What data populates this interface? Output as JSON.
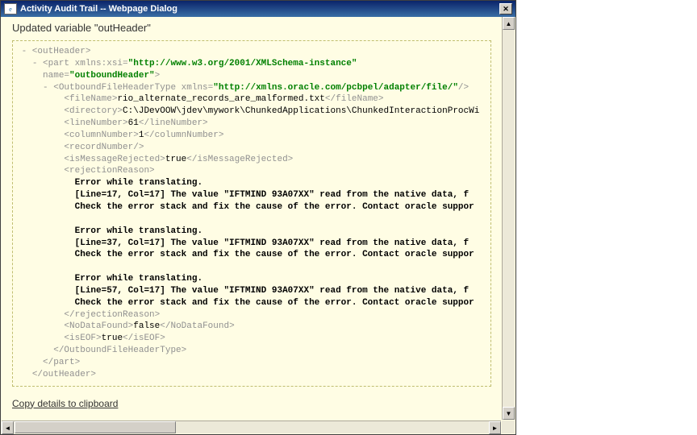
{
  "window": {
    "title": "Activity Audit Trail -- Webpage Dialog"
  },
  "heading": "Updated variable \"outHeader\"",
  "xml": {
    "root_open": "- <outHeader>",
    "part_open_pre": "- <part ",
    "part_attr_ns_name": "xmlns:xsi=",
    "part_attr_ns_val": "\"http://www.w3.org/2001/XMLSchema-instance\"",
    "part_attr_name_name": "name=",
    "part_attr_name_val": "\"outboundHeader\"",
    "close_angle": ">",
    "ofht_open_pre": "- <OutboundFileHeaderType ",
    "ofht_attr_ns_name": "xmlns=",
    "ofht_attr_ns_val": "\"http://xmlns.oracle.com/pcbpel/adapter/file/\"",
    "slash_close": "/>",
    "fileName_open": "<fileName>",
    "fileName_val": "rio_alternate_records_are_malformed.txt",
    "fileName_close": "</fileName>",
    "directory_open": "<directory>",
    "directory_val": "C:\\JDevOOW\\jdev\\mywork\\ChunkedApplications\\ChunkedInteractionProcWi",
    "lineNumber_open": "<lineNumber>",
    "lineNumber_val": "61",
    "lineNumber_close": "</lineNumber>",
    "columnNumber_open": "<columnNumber>",
    "columnNumber_val": "1",
    "columnNumber_close": "</columnNumber>",
    "recordNumber": "<recordNumber/>",
    "isMsgRej_open": "<isMessageRejected>",
    "isMsgRej_val": "true",
    "isMsgRej_close": "</isMessageRejected>",
    "rejReason_open": "<rejectionReason>",
    "err1_l1": "Error while translating.",
    "err1_l2": "[Line=17, Col=17] The value \"IFTMIND  93A07XX\" read from the native data, f",
    "err1_l3": "Check the error stack and fix the cause of the error. Contact oracle suppor",
    "err2_l1": "Error while translating.",
    "err2_l2": "[Line=37, Col=17] The value \"IFTMIND  93A07XX\" read from the native data, f",
    "err2_l3": "Check the error stack and fix the cause of the error. Contact oracle suppor",
    "err3_l1": "Error while translating.",
    "err3_l2": "[Line=57, Col=17] The value \"IFTMIND  93A07XX\" read from the native data, f",
    "err3_l3": "Check the error stack and fix the cause of the error. Contact oracle suppor",
    "rejReason_close": "</rejectionReason>",
    "noData_open": "<NoDataFound>",
    "noData_val": "false",
    "noData_close": "</NoDataFound>",
    "isEOF_open": "<isEOF>",
    "isEOF_val": "true",
    "isEOF_close": "</isEOF>",
    "ofht_close": "</OutboundFileHeaderType>",
    "part_close": "</part>",
    "root_close": "</outHeader>"
  },
  "copy_link": "Copy details to clipboard",
  "glyphs": {
    "up": "▲",
    "down": "▼",
    "left": "◄",
    "right": "►",
    "e": "e"
  }
}
